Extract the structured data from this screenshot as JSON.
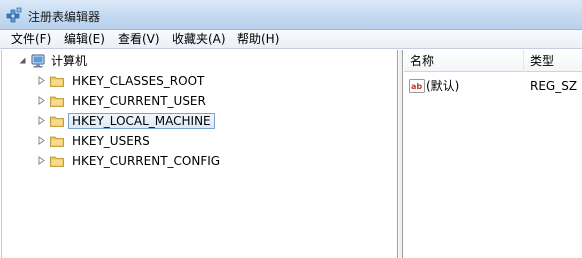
{
  "window": {
    "title": "注册表编辑器"
  },
  "menu": {
    "file": "文件(F)",
    "edit": "编辑(E)",
    "view": "查看(V)",
    "favorites": "收藏夹(A)",
    "help": "帮助(H)"
  },
  "tree": {
    "root": {
      "label": "计算机",
      "icon": "computer-icon"
    },
    "keys": [
      {
        "label": "HKEY_CLASSES_ROOT",
        "icon": "folder-icon",
        "selected": false
      },
      {
        "label": "HKEY_CURRENT_USER",
        "icon": "folder-icon",
        "selected": false
      },
      {
        "label": "HKEY_LOCAL_MACHINE",
        "icon": "folder-icon",
        "selected": true
      },
      {
        "label": "HKEY_USERS",
        "icon": "folder-icon",
        "selected": false
      },
      {
        "label": "HKEY_CURRENT_CONFIG",
        "icon": "folder-icon",
        "selected": false
      }
    ]
  },
  "list": {
    "columns": {
      "name": "名称",
      "type": "类型"
    },
    "rows": [
      {
        "name": "(默认)",
        "type": "REG_SZ",
        "icon": "string-value-icon"
      }
    ]
  },
  "colors": {
    "selection_border": "#7da2ce",
    "folder": "#e8c35a",
    "titlebar": "#c4daf2"
  }
}
